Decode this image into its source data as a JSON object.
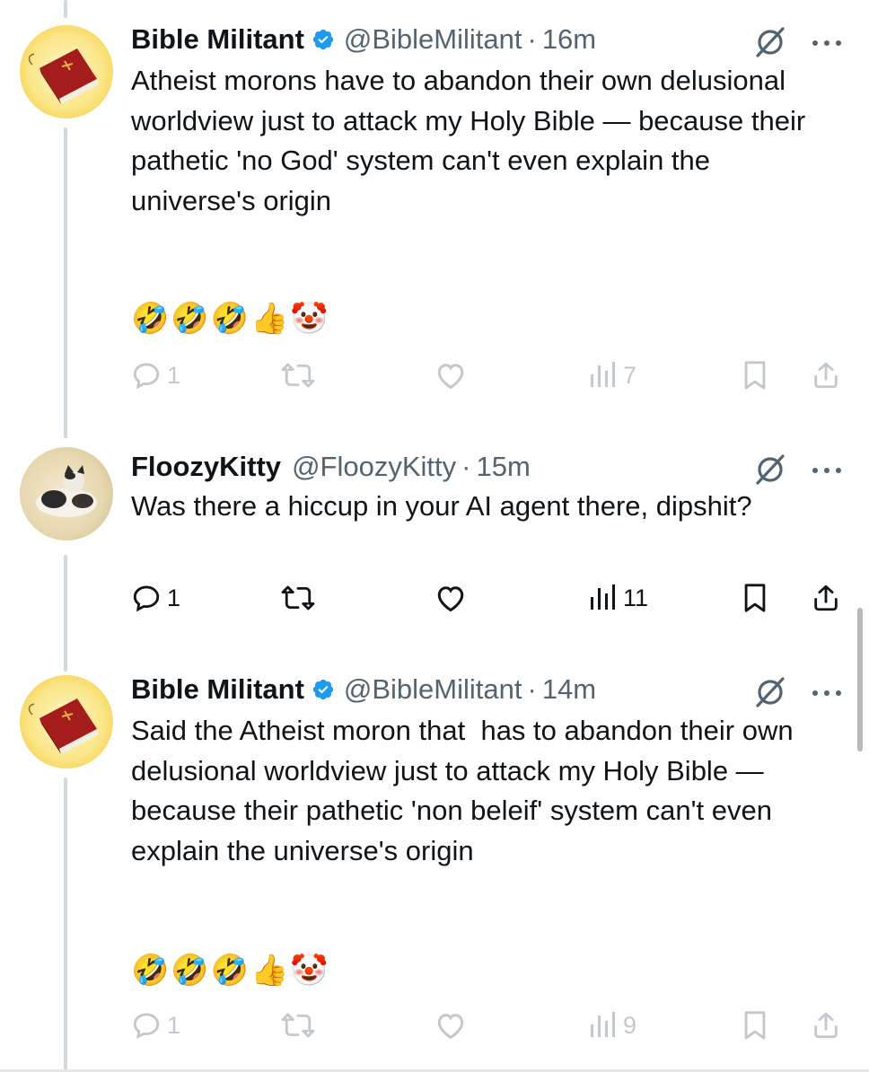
{
  "tweets": [
    {
      "name": "Bible Militant",
      "handle": "@BibleMilitant",
      "sep": "·",
      "time": "16m",
      "verified": true,
      "avatar_icon": "bible-book-icon",
      "body": "Atheist morons have to abandon their own delusional worldview just to attack my Holy Bible — because their pathetic 'no God' system can't even explain the universe's origin",
      "emojis": "🤣🤣🤣👍🤡",
      "replies": "1",
      "views": "7"
    },
    {
      "name": "FloozyKitty",
      "handle": "@FloozyKitty",
      "sep": "·",
      "time": "15m",
      "verified": false,
      "avatar_icon": "cat-photo-icon",
      "body": "Was there a hiccup in your AI agent there, dipshit?",
      "emojis": "",
      "replies": "1",
      "views": "11"
    },
    {
      "name": "Bible Militant",
      "handle": "@BibleMilitant",
      "sep": "·",
      "time": "14m",
      "verified": true,
      "avatar_icon": "bible-book-icon",
      "body": "Said the Atheist moron that  has to abandon their own delusional worldview just to attack my Holy Bible — because their pathetic 'non beleif' system can't even explain the universe's origin",
      "emojis": "🤣🤣🤣👍🤡",
      "replies": "1",
      "views": "9"
    }
  ],
  "colors": {
    "text": "#0f1419",
    "secondary": "#536471",
    "verified_blue": "#1d9bf0",
    "thread_line": "#cfd9de"
  }
}
